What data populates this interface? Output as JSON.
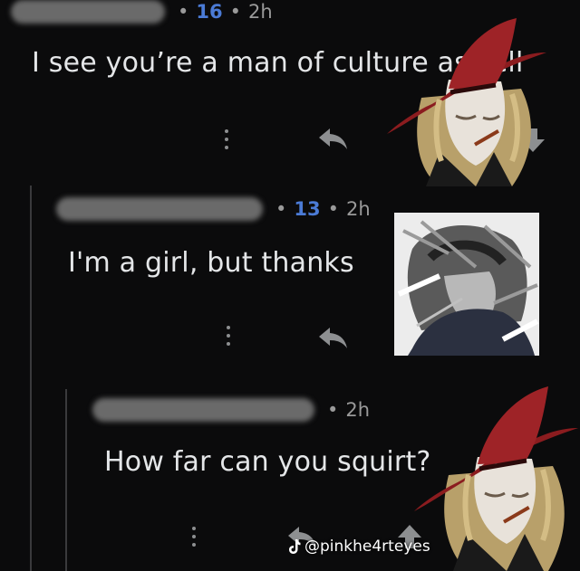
{
  "comments": [
    {
      "score": "16",
      "time": "2h",
      "text": "I see you’re a man of culture aswell"
    },
    {
      "score": "13",
      "time": "2h",
      "text": "I'm a girl, but thanks"
    },
    {
      "time": "2h",
      "text": "How far can you squirt?"
    }
  ],
  "icons": {
    "more": "more-options-icon",
    "reply": "reply-icon",
    "downvote": "downvote-icon",
    "upvote": "upvote-icon"
  },
  "watermark": {
    "handle": "@pinkhe4rteyes"
  },
  "colors": {
    "background": "#0b0b0c",
    "score": "#4b7bd6",
    "meta": "#9a9a9a",
    "text": "#e4e6e8",
    "hat": "#8b1c1f",
    "hair": "#c9b27a"
  }
}
